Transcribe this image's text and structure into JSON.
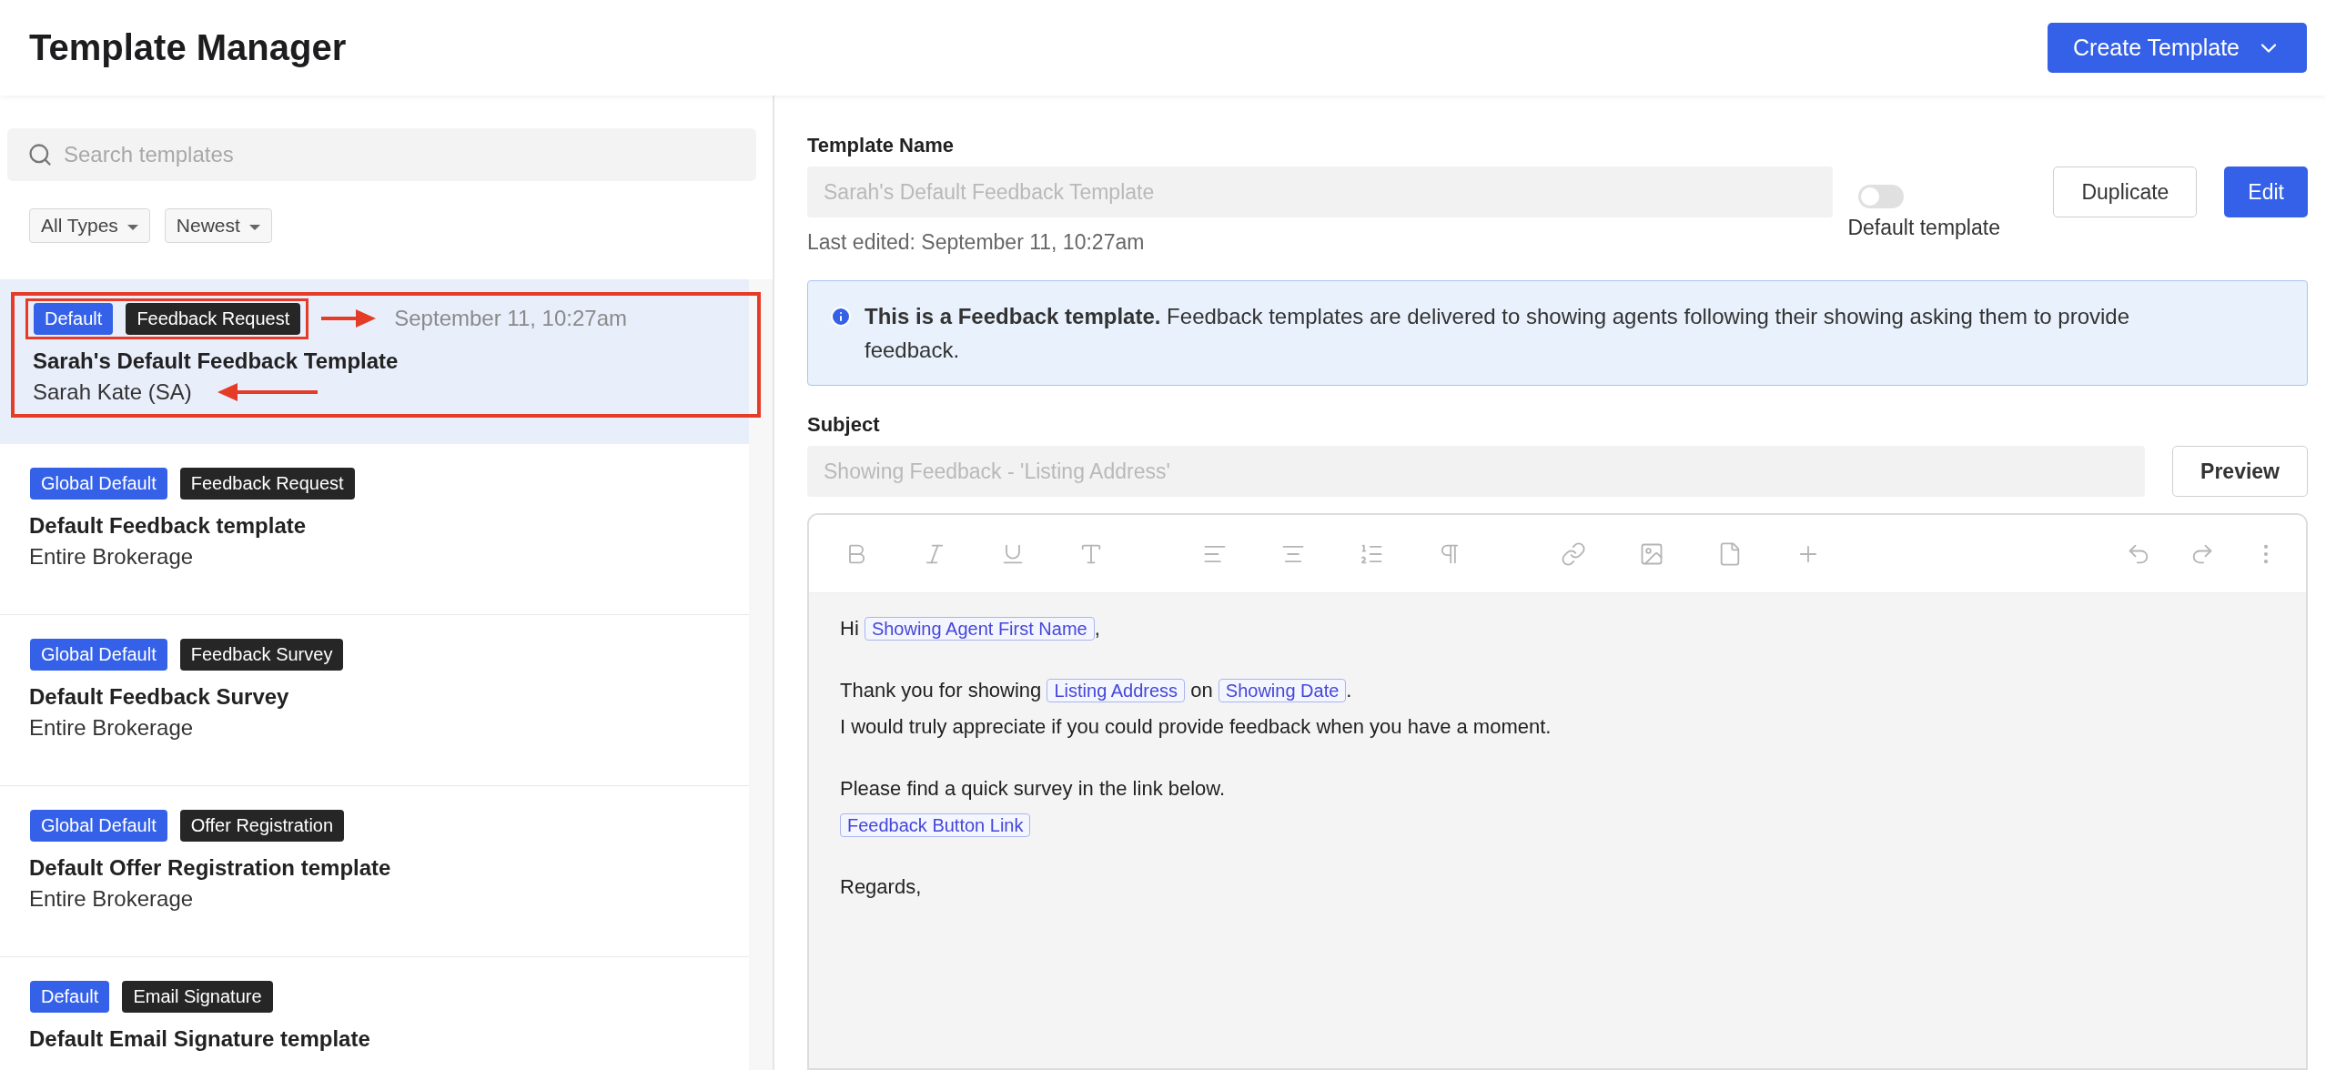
{
  "header": {
    "title": "Template Manager",
    "create_button": "Create Template"
  },
  "sidebar": {
    "search": {
      "placeholder": "Search templates"
    },
    "filters": [
      {
        "label": "All Types"
      },
      {
        "label": "Newest"
      }
    ],
    "items": [
      {
        "badges": [
          {
            "text": "Default",
            "kind": "scope"
          },
          {
            "text": "Feedback Request",
            "kind": "type"
          }
        ],
        "date": "September 11, 10:27am",
        "title": "Sarah's Default Feedback Template",
        "owner": "Sarah Kate (SA)",
        "selected": true,
        "annotated": true
      },
      {
        "badges": [
          {
            "text": "Global Default",
            "kind": "scope"
          },
          {
            "text": "Feedback Request",
            "kind": "type"
          }
        ],
        "title": "Default Feedback template",
        "owner": "Entire Brokerage",
        "selected": false,
        "annotated": false
      },
      {
        "badges": [
          {
            "text": "Global Default",
            "kind": "scope"
          },
          {
            "text": "Feedback Survey",
            "kind": "type"
          }
        ],
        "title": "Default Feedback Survey",
        "owner": "Entire Brokerage",
        "selected": false,
        "annotated": false
      },
      {
        "badges": [
          {
            "text": "Global Default",
            "kind": "scope"
          },
          {
            "text": "Offer Registration",
            "kind": "type"
          }
        ],
        "title": "Default Offer Registration template",
        "owner": "Entire Brokerage",
        "selected": false,
        "annotated": false
      },
      {
        "badges": [
          {
            "text": "Default",
            "kind": "scope"
          },
          {
            "text": "Email Signature",
            "kind": "type"
          }
        ],
        "title": "Default Email Signature template",
        "selected": false,
        "annotated": false
      }
    ]
  },
  "detail": {
    "name_label": "Template Name",
    "name_value": "Sarah's Default Feedback Template",
    "name_disabled": true,
    "last_edited": "Last edited: September 11, 10:27am",
    "default_toggle": {
      "label": "Default template",
      "on": false,
      "disabled": true
    },
    "buttons": [
      {
        "label": "Duplicate",
        "kind": "secondary"
      },
      {
        "label": "Edit",
        "kind": "primary"
      }
    ],
    "info": "**This is a Feedback template.** Feedback templates are delivered to showing agents following their showing asking them to provide feedback.",
    "subject_label": "Subject",
    "subject_value": "Showing Feedback - 'Listing Address'",
    "subject_disabled": true,
    "preview_button": "Preview",
    "editor": {
      "paragraphs": [
        {
          "lines": [
            [
              {
                "kind": "text",
                "text": "Hi "
              },
              {
                "kind": "token",
                "text": "Showing Agent First Name"
              },
              {
                "kind": "text",
                "text": ","
              }
            ]
          ]
        },
        {
          "lines": [
            [
              {
                "kind": "text",
                "text": "Thank you for showing "
              },
              {
                "kind": "token",
                "text": "Listing Address"
              },
              {
                "kind": "text",
                "text": " on "
              },
              {
                "kind": "token",
                "text": "Showing Date"
              },
              {
                "kind": "text",
                "text": "."
              }
            ],
            [
              {
                "kind": "text",
                "text": "I would truly appreciate if you could provide feedback when you have a moment."
              }
            ]
          ]
        },
        {
          "lines": [
            [
              {
                "kind": "text",
                "text": "Please find a quick survey in the link below."
              }
            ],
            [
              {
                "kind": "token",
                "text": "Feedback Button Link"
              }
            ]
          ]
        },
        {
          "lines": [
            [
              {
                "kind": "text",
                "text": "Regards,"
              }
            ]
          ]
        }
      ]
    }
  }
}
